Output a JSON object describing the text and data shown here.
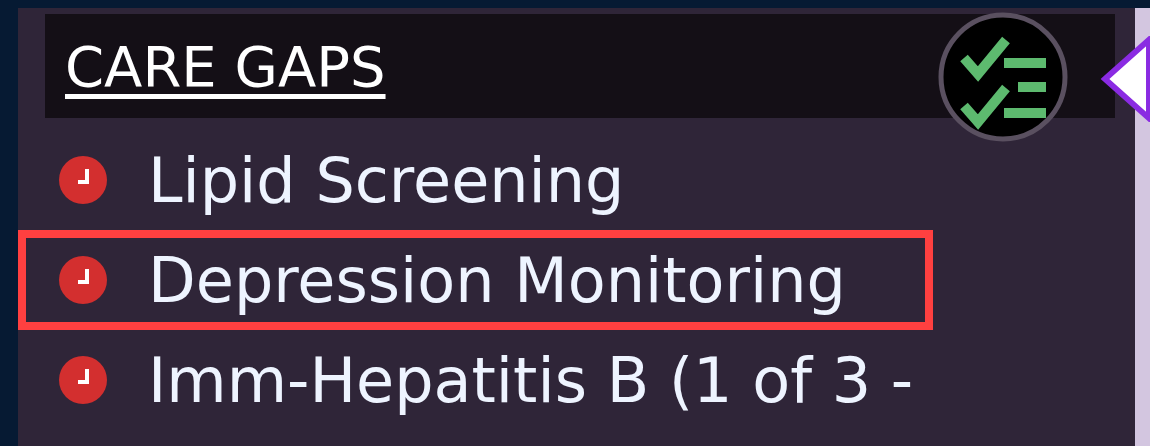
{
  "panel": {
    "title": "CARE GAPS"
  },
  "care_gaps": [
    {
      "label": "Lipid Screening",
      "selected": false
    },
    {
      "label": "Depression Monitoring",
      "selected": true
    },
    {
      "label": "Imm-Hepatitis B (1 of 3 -",
      "selected": false
    }
  ]
}
